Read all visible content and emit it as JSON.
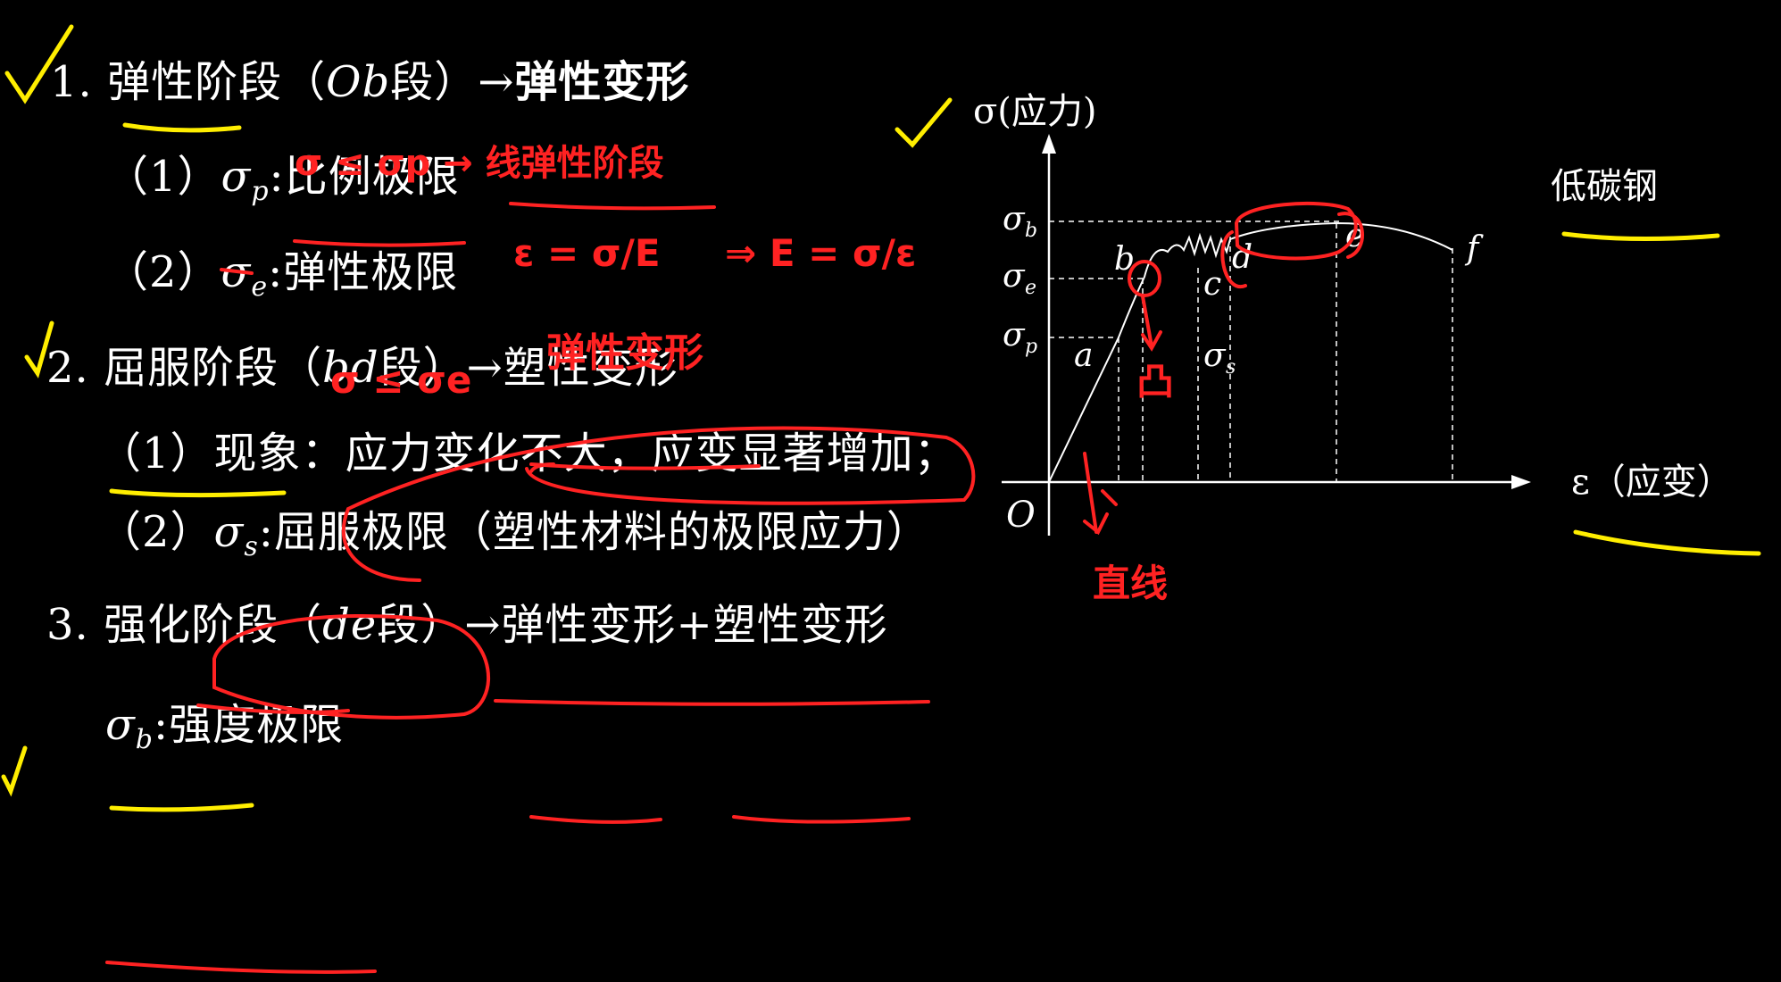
{
  "notes": {
    "stage1": {
      "num": "1.",
      "title": "弹性阶段",
      "open": "（",
      "seg": "Ob",
      "seg_word": "段",
      "close": "）",
      "arrow": "→",
      "result": "弹性变形"
    },
    "stage1_items": [
      {
        "idx": "（1）",
        "sym": "σ",
        "sub": "p",
        "colon": ":",
        "text": "比例极限"
      },
      {
        "idx": "（2）",
        "sym": "σ",
        "sub": "e",
        "colon": ":",
        "text": "弹性极限"
      }
    ],
    "stage2": {
      "num": "2.",
      "title": "屈服阶段",
      "open": "（",
      "seg": "bd",
      "seg_word": "段",
      "close": "）",
      "arrow": "→",
      "result": "塑性变形"
    },
    "stage2_items": [
      {
        "idx": "（1）",
        "label": "现象",
        "colon": "：",
        "text": "应力变化不大，应变显著增加；"
      },
      {
        "idx": "（2）",
        "sym": "σ",
        "sub": "s",
        "colon": ":",
        "text": "屈服极限",
        "note": "（塑性材料的极限应力）"
      }
    ],
    "stage3": {
      "num": "3.",
      "title": "强化阶段",
      "open": "（",
      "seg": "de",
      "seg_word": "段",
      "close": "）",
      "arrow": "→",
      "result_a": "弹性变形",
      "plus": "+",
      "result_b": "塑性变形"
    },
    "strength": {
      "sym": "σ",
      "sub": "b",
      "colon": ":",
      "text": "强度极限"
    }
  },
  "diagram": {
    "y_axis": "σ(应力)",
    "x_axis": "ε（应变）",
    "origin": "O",
    "material": "低碳钢",
    "y_labels": [
      {
        "sym": "σ",
        "sub": "b"
      },
      {
        "sym": "σ",
        "sub": "e"
      },
      {
        "sym": "σ",
        "sub": "p"
      }
    ],
    "points": [
      "a",
      "b",
      "c",
      "d",
      "e",
      "f"
    ],
    "sigma_s": {
      "sym": "σ",
      "sub": "s"
    }
  },
  "handwriting": {
    "note_top": "σ ≤ σp → 线弹性阶段",
    "formula_left": "ε = σ/E",
    "formula_right": "⇒ E = σ/ε",
    "note_e": "σ ≤ σe",
    "note_elastic": "弹性变形",
    "note_convex": "凸",
    "note_line": "直线"
  },
  "colors": {
    "background": "#000000",
    "text": "#ffffff",
    "marker_red": "#ff2222",
    "marker_yellow": "#ffee00"
  }
}
